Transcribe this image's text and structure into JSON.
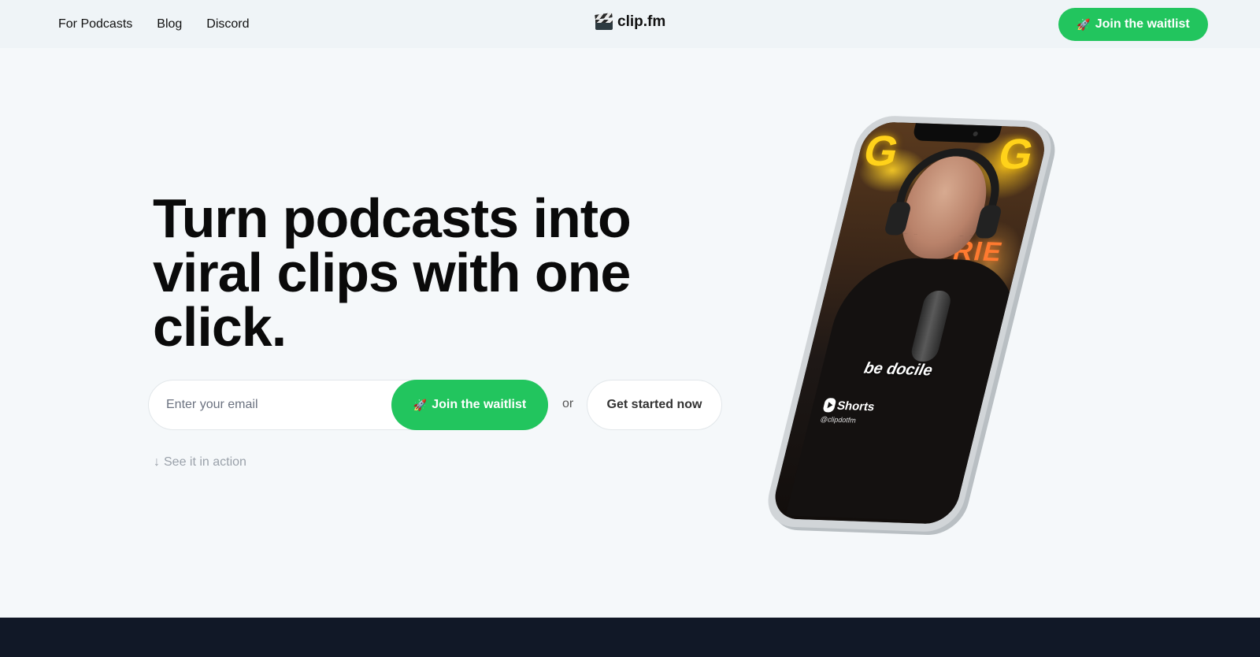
{
  "nav": {
    "links": [
      "For Podcasts",
      "Blog",
      "Discord"
    ]
  },
  "brand": {
    "name": "clip.fm",
    "icon": "clapperboard-icon"
  },
  "header": {
    "cta_label": "Join the waitlist"
  },
  "hero": {
    "title": "Turn podcasts into viral clips with one click.",
    "email_placeholder": "Enter your email",
    "form_cta_label": "Join the waitlist",
    "or_text": "or",
    "secondary_cta_label": "Get started now",
    "see_action_label": "See it in action"
  },
  "phone": {
    "caption": "be docile",
    "shorts_label": "Shorts",
    "handle": "@clipdotfm"
  },
  "colors": {
    "accent": "#22c55e",
    "background": "#f5f8fa",
    "header_bg": "#eff4f7",
    "footer_band": "#111827"
  }
}
